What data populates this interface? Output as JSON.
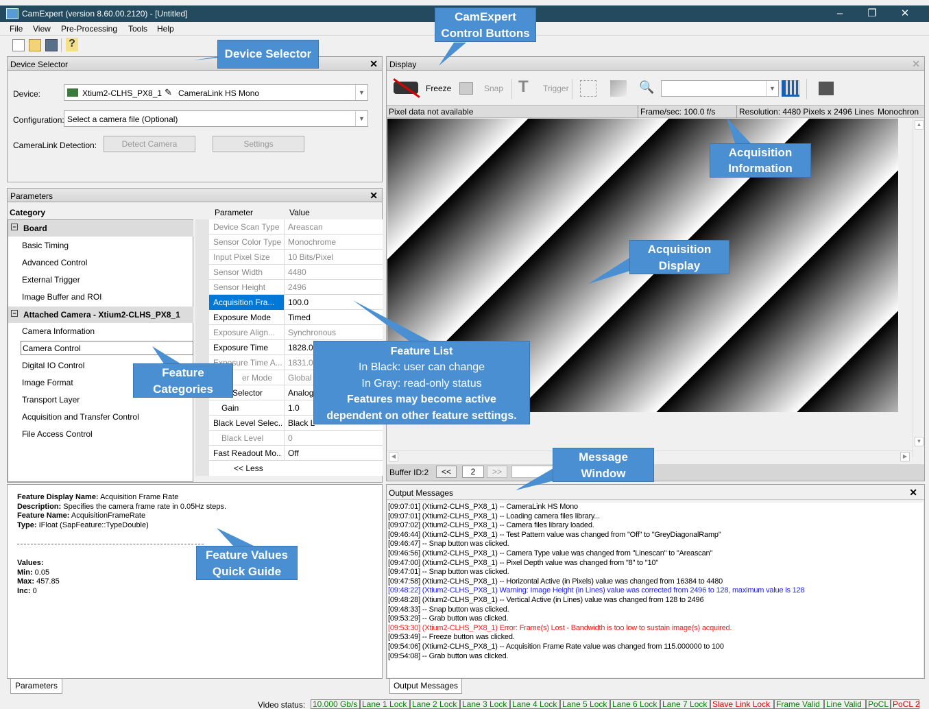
{
  "app": {
    "title": "CamExpert (version 8.60.00.2120) - [Untitled]"
  },
  "window_controls": {
    "minimize": "–",
    "restore": "❐",
    "close": "✕"
  },
  "menu": [
    "File",
    "View",
    "Pre-Processing",
    "Tools",
    "Help"
  ],
  "device_selector": {
    "title": "Device Selector",
    "device_label": "Device:",
    "device_value": "Xtium2-CLHS_PX8_1",
    "camera_value": "CameraLink HS Mono",
    "config_label": "Configuration:",
    "config_value": "Select a camera file (Optional)",
    "detection_label": "CameraLink Detection:",
    "detect_button": "Detect Camera",
    "settings_button": "Settings"
  },
  "parameters": {
    "title": "Parameters",
    "category_header": "Category",
    "param_header": "Parameter",
    "value_header": "Value",
    "categories": [
      {
        "type": "group",
        "label": "Board"
      },
      {
        "type": "item",
        "label": "Basic Timing"
      },
      {
        "type": "item",
        "label": "Advanced Control"
      },
      {
        "type": "item",
        "label": "External Trigger"
      },
      {
        "type": "item",
        "label": "Image Buffer and ROI"
      },
      {
        "type": "group",
        "label": "Attached Camera - Xtium2-CLHS_PX8_1"
      },
      {
        "type": "item",
        "label": "Camera Information"
      },
      {
        "type": "item",
        "label": "Camera Control"
      },
      {
        "type": "item",
        "label": "Digital IO Control"
      },
      {
        "type": "item",
        "label": "Image Format"
      },
      {
        "type": "item",
        "label": "Transport Layer"
      },
      {
        "type": "item",
        "label": "Acquisition and Transfer Control"
      },
      {
        "type": "item",
        "label": "File Access Control"
      }
    ],
    "rows": [
      {
        "name": "Device Scan Type",
        "value": "Areascan",
        "readonly": true
      },
      {
        "name": "Sensor Color Type",
        "value": "Monochrome",
        "readonly": true
      },
      {
        "name": "Input Pixel Size",
        "value": "10 Bits/Pixel",
        "readonly": true
      },
      {
        "name": "Sensor Width",
        "value": "4480",
        "readonly": true
      },
      {
        "name": "Sensor Height",
        "value": "2496",
        "readonly": true
      },
      {
        "name": "Acquisition Fra...",
        "value": "100.0",
        "readonly": false,
        "selected": true
      },
      {
        "name": "Exposure Mode",
        "value": "Timed",
        "readonly": false
      },
      {
        "name": "Exposure Align...",
        "value": "Synchronous",
        "readonly": true
      },
      {
        "name": "Exposure Time",
        "value": "1828.0",
        "readonly": false
      },
      {
        "name": "Exposure Time A...",
        "value": "1831.0",
        "readonly": true
      },
      {
        "name": "er Mode",
        "value": "Global",
        "readonly": true
      },
      {
        "name": "Selector",
        "value": "Analog",
        "readonly": false
      },
      {
        "name": "Gain",
        "value": "1.0",
        "readonly": false
      },
      {
        "name": "Black Level Selec...",
        "value": "Black L",
        "readonly": false
      },
      {
        "name": "Black Level",
        "value": "0",
        "readonly": true
      },
      {
        "name": "Fast Readout Mo...",
        "value": "Off",
        "readonly": false
      }
    ],
    "less_label": "<< Less"
  },
  "quick_guide": {
    "display_name_label": "Feature Display Name:",
    "display_name": "Acquisition Frame Rate",
    "description_label": "Description:",
    "description": "Specifies the camera frame rate in 0.05Hz steps.",
    "feature_name_label": "Feature Name:",
    "feature_name": "AcquisitionFrameRate",
    "type_label": "Type:",
    "type": "IFloat (SapFeature::TypeDouble)",
    "values_label": "Values:",
    "min_label": "Min:",
    "min": "0.05",
    "max_label": "Max:",
    "max": "457.85",
    "inc_label": "Inc:",
    "inc": "0",
    "tab": "Parameters"
  },
  "display": {
    "title": "Display",
    "freeze": "Freeze",
    "snap": "Snap",
    "trigger": "Trigger",
    "pixel_data": "Pixel data not available",
    "frame_rate": "Frame/sec: 100.0 f/s",
    "resolution": "Resolution: 4480 Pixels x 2496 Lines",
    "color_mode": "Monochron",
    "buffer_id": "Buffer ID:2",
    "prev": "<<",
    "buffer_num": "2",
    "next": ">>"
  },
  "output": {
    "title": "Output Messages",
    "tab": "Output Messages",
    "messages": [
      {
        "text": "[09:07:01] (Xtium2-CLHS_PX8_1) -- CameraLink HS Mono",
        "color": "#000000"
      },
      {
        "text": "[09:07:01] (Xtium2-CLHS_PX8_1) -- Loading camera files library...",
        "color": "#000000"
      },
      {
        "text": "[09:07:02] (Xtium2-CLHS_PX8_1) -- Camera files library loaded.",
        "color": "#000000"
      },
      {
        "text": "[09:46:44] (Xtium2-CLHS_PX8_1) -- Test Pattern value was changed from \"Off\" to \"GreyDiagonalRamp\"",
        "color": "#000000"
      },
      {
        "text": "[09:46:47] -- Snap button was clicked.",
        "color": "#000000"
      },
      {
        "text": "[09:46:56] (Xtium2-CLHS_PX8_1) -- Camera Type value was changed from \"Linescan\" to \"Areascan\"",
        "color": "#000000"
      },
      {
        "text": "[09:47:00] (Xtium2-CLHS_PX8_1) -- Pixel Depth value was changed from \"8\" to \"10\"",
        "color": "#000000"
      },
      {
        "text": "[09:47:01] -- Snap button was clicked.",
        "color": "#000000"
      },
      {
        "text": "[09:47:58] (Xtium2-CLHS_PX8_1) -- Horizontal Active (in Pixels) value was changed from 16384 to 4480",
        "color": "#000000"
      },
      {
        "text": "[09:48:22] (Xtium2-CLHS_PX8_1) Warning: Image Height (in Lines) value was corrected from 2496 to 128, maximum value is 128",
        "color": "#1a1aff"
      },
      {
        "text": "[09:48:28] (Xtium2-CLHS_PX8_1) -- Vertical Active (in Lines) value was changed from 128 to 2496",
        "color": "#000000"
      },
      {
        "text": "[09:48:33] -- Snap button was clicked.",
        "color": "#000000"
      },
      {
        "text": "[09:53:29] -- Grab button was clicked.",
        "color": "#000000"
      },
      {
        "text": "[09:53:30] (Xtium2-CLHS_PX8_1) Error: Frame(s) Lost - Bandwidth is too low to sustain image(s) acquired.",
        "color": "#ff1a1a"
      },
      {
        "text": "[09:53:49] -- Freeze button was clicked.",
        "color": "#000000"
      },
      {
        "text": "[09:54:06] (Xtium2-CLHS_PX8_1) -- Acquisition Frame Rate value was changed from 115.000000 to 100",
        "color": "#000000"
      },
      {
        "text": "[09:54:08] -- Grab button was clicked.",
        "color": "#000000"
      }
    ]
  },
  "video_status": {
    "label": "Video status:",
    "items": [
      {
        "text": "10.000 Gb/s",
        "color": "#008000"
      },
      {
        "text": "Lane 1 Lock",
        "color": "#008000"
      },
      {
        "text": "Lane 2 Lock",
        "color": "#008000"
      },
      {
        "text": "Lane 3 Lock",
        "color": "#008000"
      },
      {
        "text": "Lane 4 Lock",
        "color": "#008000"
      },
      {
        "text": "Lane 5 Lock",
        "color": "#008000"
      },
      {
        "text": "Lane 6 Lock",
        "color": "#008000"
      },
      {
        "text": "Lane 7 Lock",
        "color": "#008000"
      },
      {
        "text": "Slave Link Lock",
        "color": "#e00000"
      },
      {
        "text": "Frame Valid",
        "color": "#008000"
      },
      {
        "text": "Line Valid",
        "color": "#008000"
      },
      {
        "text": "PoCL",
        "color": "#008000"
      },
      {
        "text": "PoCL 2",
        "color": "#e00000"
      }
    ]
  },
  "callouts": {
    "control_buttons": [
      "CamExpert",
      "Control Buttons"
    ],
    "device_selector": "Device Selector",
    "acq_info": [
      "Acquisition",
      "Information"
    ],
    "acq_display": [
      "Acquisition",
      "Display"
    ],
    "feature_list": {
      "title": "Feature List",
      "line1": "In Black: user can change",
      "line2": "In Gray: read-only status",
      "line3": "Features may become active",
      "line4": "dependent on other feature settings."
    },
    "feature_categories": [
      "Feature",
      "Categories"
    ],
    "message_window": [
      "Message",
      "Window"
    ],
    "quick_guide": [
      "Feature Values",
      "Quick Guide"
    ]
  },
  "colors": {
    "titlebar": "#234a5e",
    "callout": "#4a8fd1",
    "selection": "#0078d7"
  }
}
